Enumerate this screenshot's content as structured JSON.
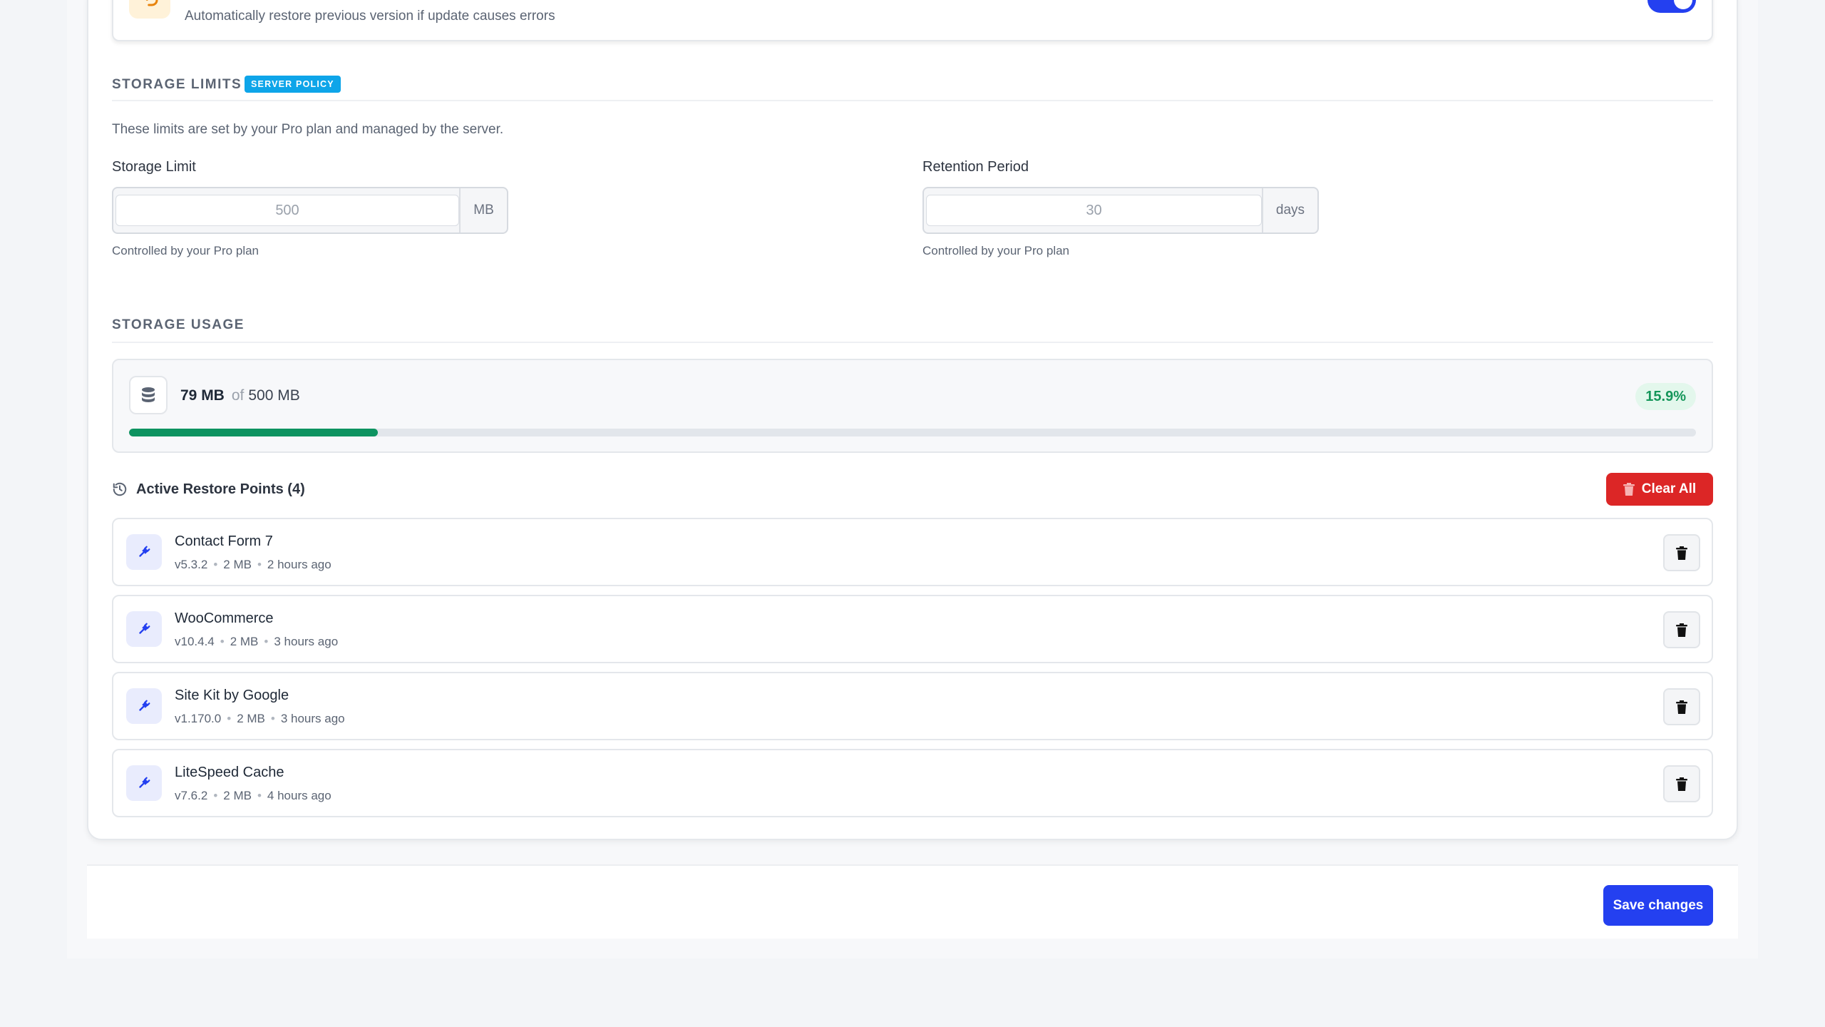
{
  "rollback": {
    "description": "Automatically restore previous version if update causes errors",
    "enabled": true,
    "icon": "undo-icon"
  },
  "storage_limits": {
    "title": "STORAGE LIMITS",
    "badge": "SERVER POLICY",
    "description": "These limits are set by your Pro plan and managed by the server.",
    "storage_limit": {
      "label": "Storage Limit",
      "placeholder": "500",
      "unit": "MB",
      "hint": "Controlled by your Pro plan"
    },
    "retention": {
      "label": "Retention Period",
      "placeholder": "30",
      "unit": "days",
      "hint": "Controlled by your Pro plan"
    }
  },
  "storage_usage": {
    "title": "STORAGE USAGE",
    "used": "79 MB",
    "of": "of",
    "total": "500 MB",
    "percent_label": "15.9%",
    "percent": 15.9,
    "icon": "database-icon"
  },
  "restore_points": {
    "title": "Active Restore Points (4)",
    "clear_label": "Clear All",
    "items": [
      {
        "name": "Contact Form 7",
        "version": "v5.3.2",
        "size": "2 MB",
        "time": "2 hours ago"
      },
      {
        "name": "WooCommerce",
        "version": "v10.4.4",
        "size": "2 MB",
        "time": "3 hours ago"
      },
      {
        "name": "Site Kit by Google",
        "version": "v1.170.0",
        "size": "2 MB",
        "time": "3 hours ago"
      },
      {
        "name": "LiteSpeed Cache",
        "version": "v7.6.2",
        "size": "2 MB",
        "time": "4 hours ago"
      }
    ]
  },
  "footer": {
    "save_label": "Save changes"
  },
  "colors": {
    "accent": "#2440f0",
    "danger": "#dc2626",
    "success": "#0d9360",
    "info": "#0ea5e9"
  }
}
